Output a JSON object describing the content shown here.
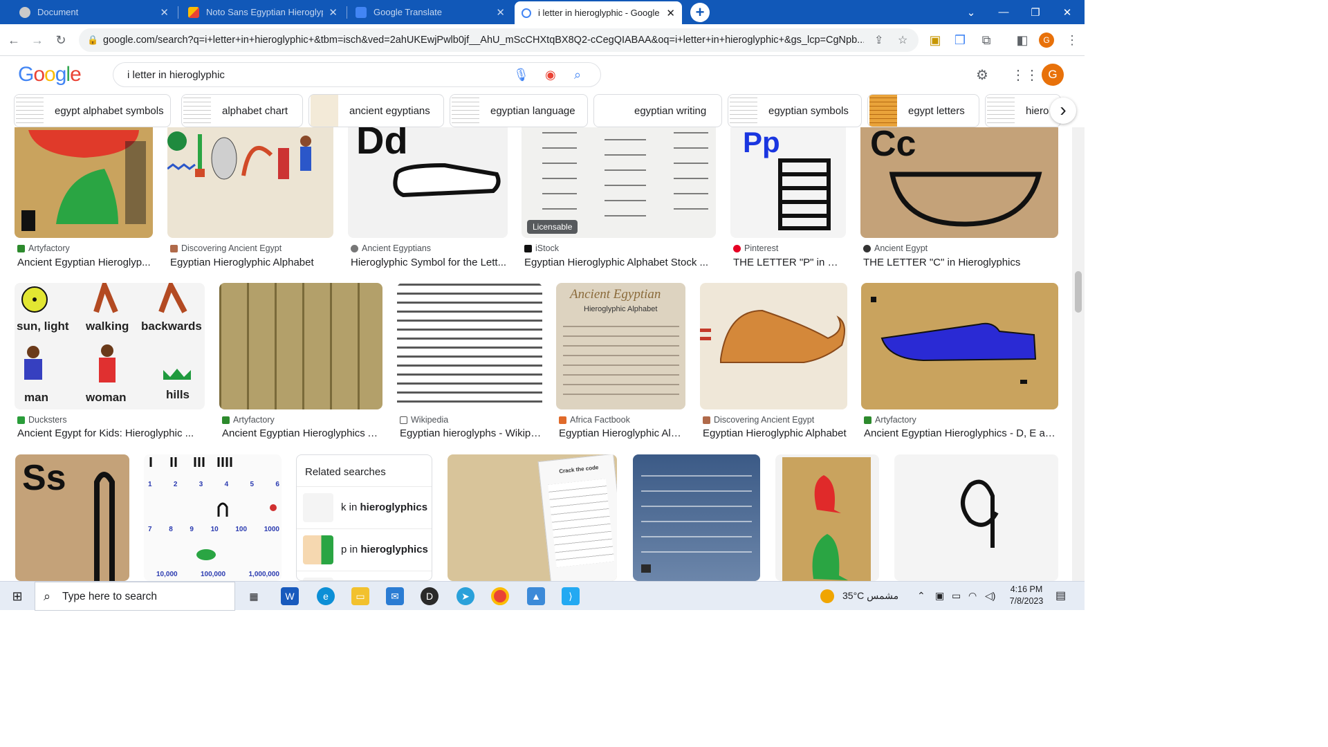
{
  "browser": {
    "tabs": [
      {
        "label": "Document",
        "color": "#e6e6e6"
      },
      {
        "label": "Noto Sans Egyptian Hieroglyph",
        "color": "#ea4335"
      },
      {
        "label": "Google Translate",
        "color": "#4285f4"
      },
      {
        "label": "i letter in hieroglyphic - Google",
        "color": "#4285f4"
      }
    ],
    "new_tab": "+",
    "url": "google.com/search?q=i+letter+in+hieroglyphic+&tbm=isch&ved=2ahUKEwjPwlb0jf__AhU_mScCHXtqBX8Q2-cCegQIABAA&oq=i+letter+in+hieroglyphic+&gs_lcp=CgNpb...",
    "profile_initial": "G"
  },
  "google": {
    "logo": "Google",
    "query": "i letter in hieroglyphic",
    "avatar_initial": "G",
    "chips": [
      "egypt alphabet symbols",
      "alphabet chart",
      "ancient egyptians",
      "egyptian language",
      "egyptian writing",
      "egyptian symbols",
      "egypt letters",
      "hiero"
    ]
  },
  "results": {
    "row1": [
      {
        "source": "Artyfactory",
        "title": "Ancient Egyptian Hieroglyp..."
      },
      {
        "source": "Discovering Ancient Egypt",
        "title": "Egyptian Hieroglyphic Alphabet"
      },
      {
        "source": "Ancient Egyptians",
        "title": "Hieroglyphic Symbol for the Lett..."
      },
      {
        "source": "iStock",
        "title": "Egyptian Hieroglyphic Alphabet Stock ...",
        "badge": "Licensable"
      },
      {
        "source": "Pinterest",
        "title": "THE LETTER \"P\" in Hie..."
      },
      {
        "source": "Ancient Egypt",
        "title": "THE LETTER \"C\" in Hieroglyphics"
      }
    ],
    "row2": [
      {
        "source": "Ducksters",
        "title": "Ancient Egypt for Kids: Hieroglyphic ..."
      },
      {
        "source": "Artyfactory",
        "title": "Ancient Egyptian Hieroglyphics A..."
      },
      {
        "source": "Wikipedia",
        "title": "Egyptian hieroglyphs - Wikipe..."
      },
      {
        "source": "Africa Factbook",
        "title": "Egyptian Hieroglyphic Alp..."
      },
      {
        "source": "Discovering Ancient Egypt",
        "title": "Egyptian Hieroglyphic Alphabet"
      },
      {
        "source": "Artyfactory",
        "title": "Ancient Egyptian Hieroglyphics - D, E and..."
      }
    ],
    "image_text": {
      "dd": "Dd",
      "pp": "Pp",
      "cc": "Cc",
      "ss": "Ss",
      "sun": "sun, light",
      "walking": "walking",
      "backwards": "backwards",
      "man": "man",
      "woman": "woman",
      "hills": "hills",
      "ae_title": "Ancient Egyptian",
      "ae_sub": "Hieroglyphic Alphabet",
      "nums": [
        "1",
        "2",
        "3",
        "4",
        "5",
        "6",
        "7",
        "8",
        "9",
        "10",
        "100",
        "1000",
        "10,000",
        "100,000",
        "1,000,000"
      ],
      "crack": "Crack the code"
    },
    "related": {
      "title": "Related searches",
      "items": [
        {
          "pre": "k",
          "mid": " in ",
          "bold": "hieroglyphics"
        },
        {
          "pre": "p",
          "mid": " in ",
          "bold": "hieroglyphics"
        }
      ]
    }
  },
  "taskbar": {
    "search_placeholder": "Type here to search",
    "weather": "35°C  مشمس",
    "time": "4:16 PM",
    "date": "7/8/2023"
  }
}
